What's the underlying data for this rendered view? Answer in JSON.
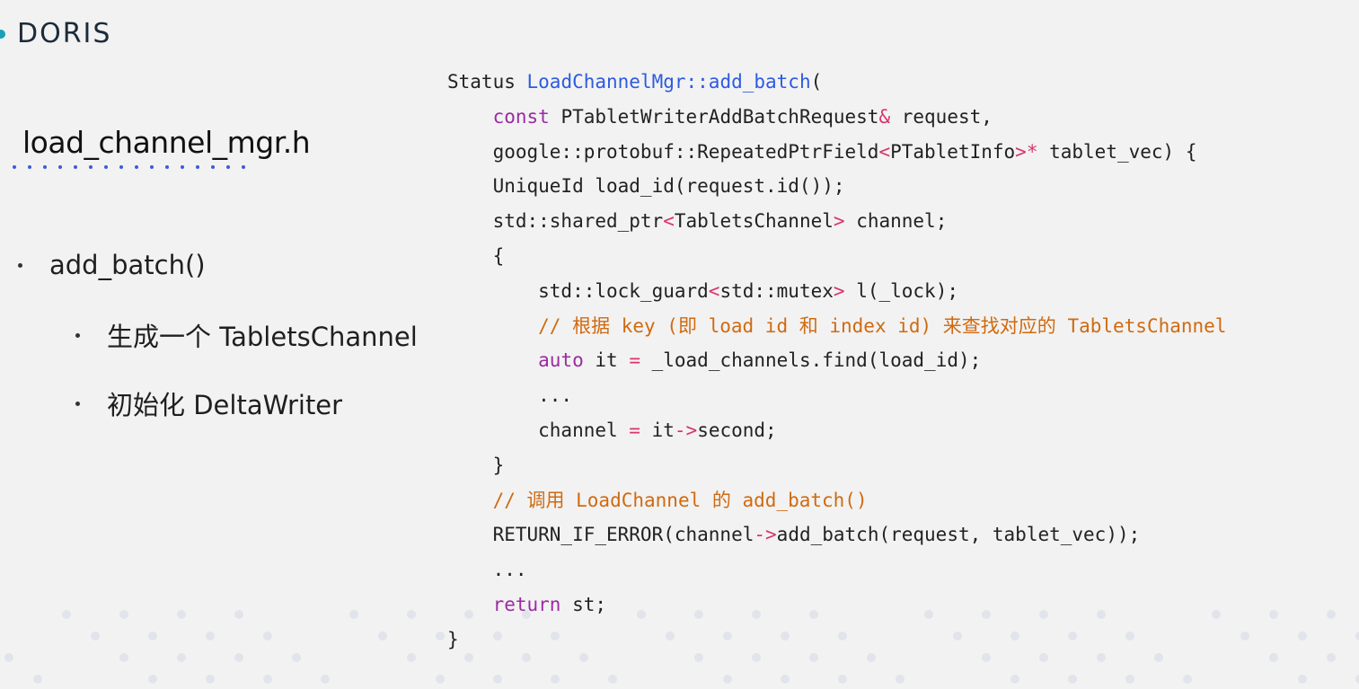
{
  "header": {
    "logo_text": "DORIS",
    "brand_color": "#18a0b8"
  },
  "slide": {
    "file_title": "load_channel_mgr.h",
    "bullets": [
      {
        "text": "add_batch()"
      },
      {
        "text": "生成一个 TabletsChannel"
      },
      {
        "text": "初始化 DeltaWriter"
      }
    ]
  },
  "code": {
    "lines": [
      [
        {
          "t": "Status "
        },
        {
          "t": "LoadChannelMgr::add_batch",
          "c": "fn"
        },
        {
          "t": "("
        }
      ],
      [
        {
          "t": "    "
        },
        {
          "t": "const",
          "c": "kw"
        },
        {
          "t": " PTabletWriterAddBatchRequest"
        },
        {
          "t": "&",
          "c": "op"
        },
        {
          "t": " request,"
        }
      ],
      [
        {
          "t": "    google::protobuf::RepeatedPtrField"
        },
        {
          "t": "<",
          "c": "op"
        },
        {
          "t": "PTabletInfo"
        },
        {
          "t": ">*",
          "c": "op"
        },
        {
          "t": " tablet_vec) {"
        }
      ],
      [
        {
          "t": "    UniqueId load_id(request.id());"
        }
      ],
      [
        {
          "t": "    std::shared_ptr"
        },
        {
          "t": "<",
          "c": "op"
        },
        {
          "t": "TabletsChannel"
        },
        {
          "t": ">",
          "c": "op"
        },
        {
          "t": " channel;"
        }
      ],
      [
        {
          "t": "    {"
        }
      ],
      [
        {
          "t": "        std::lock_guard"
        },
        {
          "t": "<",
          "c": "op"
        },
        {
          "t": "std::mutex"
        },
        {
          "t": ">",
          "c": "op"
        },
        {
          "t": " l(_lock);"
        }
      ],
      [
        {
          "t": "        "
        },
        {
          "t": "// 根据 key (即 load id 和 index id) 来查找对应的 TabletsChannel",
          "c": "cm"
        }
      ],
      [
        {
          "t": "        "
        },
        {
          "t": "auto",
          "c": "kw"
        },
        {
          "t": " it "
        },
        {
          "t": "=",
          "c": "op"
        },
        {
          "t": " _load_channels.find(load_id);"
        }
      ],
      [
        {
          "t": "        ..."
        }
      ],
      [
        {
          "t": "        channel "
        },
        {
          "t": "=",
          "c": "op"
        },
        {
          "t": " it"
        },
        {
          "t": "->",
          "c": "op"
        },
        {
          "t": "second;"
        }
      ],
      [
        {
          "t": "    }"
        }
      ],
      [
        {
          "t": "    "
        },
        {
          "t": "// 调用 LoadChannel 的 add_batch()",
          "c": "cm"
        }
      ],
      [
        {
          "t": "    RETURN_IF_ERROR(channel"
        },
        {
          "t": "->",
          "c": "op"
        },
        {
          "t": "add_batch(request, tablet_vec));"
        }
      ],
      [
        {
          "t": "    ..."
        }
      ],
      [
        {
          "t": "    "
        },
        {
          "t": "return",
          "c": "kw"
        },
        {
          "t": " st;"
        }
      ],
      [
        {
          "t": "}"
        }
      ]
    ]
  }
}
